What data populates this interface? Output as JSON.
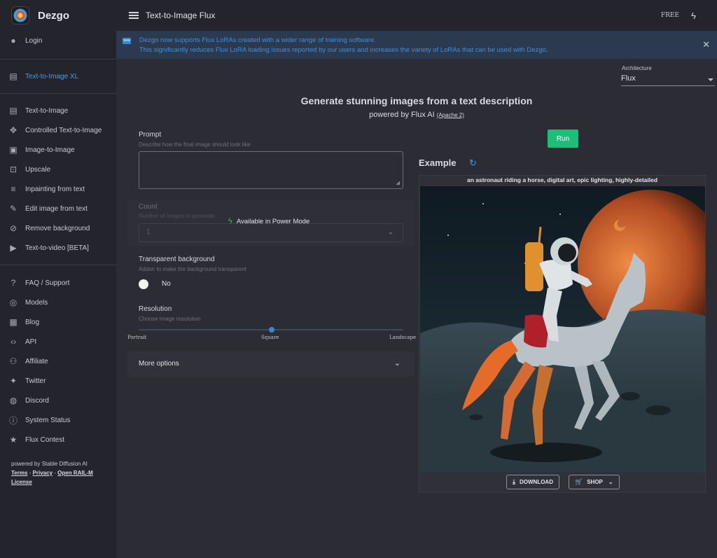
{
  "app": {
    "name": "Dezgo",
    "page_title": "Text-to-Image Flux",
    "plan": "FREE"
  },
  "sidebar": {
    "login": "Login",
    "featured": "Text-to-Image XL",
    "tools": [
      {
        "label": "Text-to-Image",
        "icon": "text-icon"
      },
      {
        "label": "Controlled Text-to-Image",
        "icon": "control-icon"
      },
      {
        "label": "Image-to-Image",
        "icon": "image-icon"
      },
      {
        "label": "Upscale",
        "icon": "upscale-icon"
      },
      {
        "label": "Inpainting from text",
        "icon": "inpaint-icon"
      },
      {
        "label": "Edit image from text",
        "icon": "edit-icon"
      },
      {
        "label": "Remove background",
        "icon": "remove-bg-icon"
      },
      {
        "label": "Text-to-video [BETA]",
        "icon": "video-icon"
      }
    ],
    "links": [
      {
        "label": "FAQ / Support",
        "icon": "help-icon"
      },
      {
        "label": "Models",
        "icon": "models-icon"
      },
      {
        "label": "Blog",
        "icon": "blog-icon"
      },
      {
        "label": "API",
        "icon": "code-icon"
      },
      {
        "label": "Affiliate",
        "icon": "group-icon"
      },
      {
        "label": "Twitter",
        "icon": "twitter-icon"
      },
      {
        "label": "Discord",
        "icon": "discord-icon"
      },
      {
        "label": "System Status",
        "icon": "info-icon"
      },
      {
        "label": "Flux Contest",
        "icon": "star-icon"
      }
    ],
    "footer": {
      "powered": "powered by Stable Diffusion AI",
      "terms": "Terms",
      "privacy": "Privacy",
      "rail": "Open RAIL-M",
      "license": "License"
    }
  },
  "banner": {
    "line1": "Dezgo now supports Flux LoRAs created with a wider range of training software.",
    "line2": "This significantly reduces Flux LoRA loading issues reported by our users and increases the variety of LoRAs that can be used with Dezgo.",
    "icon_text": "new"
  },
  "architecture": {
    "label": "Architecture",
    "value": "Flux"
  },
  "header": {
    "headline": "Generate stunning images from a text description",
    "powered": "powered by Flux AI",
    "license": "(Apache 2)"
  },
  "form": {
    "prompt_label": "Prompt",
    "prompt_hint": "Describe how the final image should look like",
    "prompt_value": "",
    "count_label": "Count",
    "count_hint": "Number of images to generate",
    "count_value": "1",
    "power_mode": "Available in Power Mode",
    "transparent_label": "Transparent background",
    "transparent_hint": "Addon to make the background transparent",
    "transparent_value": "No",
    "resolution_label": "Resolution",
    "resolution_hint": "Choose image resolution",
    "resolution_options": [
      "Portrait",
      "Square",
      "Landscape"
    ],
    "resolution_selected": "Square",
    "more_options": "More options"
  },
  "run_label": "Run",
  "example": {
    "title": "Example",
    "caption": "an astronaut riding a horse, digital art, epic lighting, highly-detailed",
    "download": "DOWNLOAD",
    "shop": "SHOP"
  },
  "colors": {
    "accent": "#3d85d6",
    "run": "#1ebd7a",
    "sidebar": "#24252c",
    "background": "#2b2c34"
  }
}
